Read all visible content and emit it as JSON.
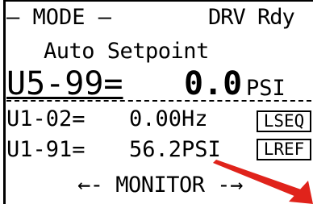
{
  "header": {
    "mode_title": "– MODE –",
    "drive_status": "DRV Rdy"
  },
  "subtitle": "Auto Setpoint",
  "setpoint": {
    "code": "U5-99=",
    "value": "0.0",
    "unit": "PSI"
  },
  "monitors": [
    {
      "code": "U1-02=",
      "value": "0.00Hz"
    },
    {
      "code": "U1-91=",
      "value": "56.2PSI"
    }
  ],
  "indicators": {
    "lseq": "LSEQ",
    "lref": "LREF"
  },
  "footer": {
    "monitor_label": "←- MONITOR -→"
  },
  "colors": {
    "text": "#000000",
    "background": "#ffffff",
    "annotation_arrow": "#e0231b"
  }
}
